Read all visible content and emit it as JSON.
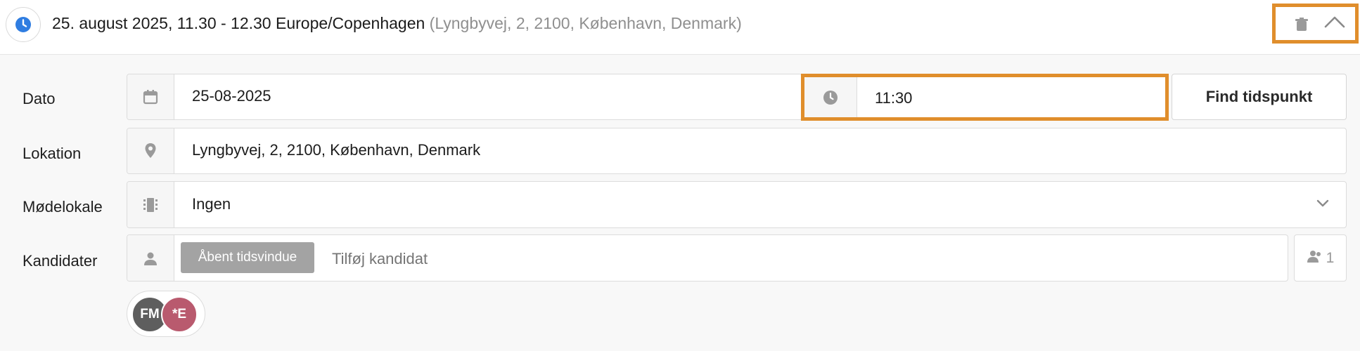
{
  "header": {
    "title": "25. august 2025, 11.30 - 12.30 Europe/Copenhagen",
    "location": "(Lyngbyvej, 2, 2100, København, Denmark)",
    "icons": {
      "clock": "clock-icon",
      "trash": "trash-icon",
      "collapse": "chevron-up-icon"
    }
  },
  "form": {
    "date": {
      "label": "Dato",
      "value": "25-08-2025",
      "icon": "calendar-icon"
    },
    "time": {
      "value": "11:30",
      "icon": "clock-icon"
    },
    "find_button": "Find tidspunkt",
    "location": {
      "label": "Lokation",
      "value": "Lyngbyvej, 2, 2100, København, Denmark",
      "icon": "map-pin-icon"
    },
    "room": {
      "label": "Mødelokale",
      "value": "Ingen",
      "icon": "meeting-room-icon"
    },
    "candidates": {
      "label": "Kandidater",
      "tag": "Åbent tidsvindue",
      "placeholder": "Tilføj kandidat",
      "count": "1",
      "icon": "person-icon"
    },
    "avatars": [
      {
        "initials": "FM",
        "color": "#5e5e5e"
      },
      {
        "initials": "*E",
        "color": "#b95a6e"
      }
    ]
  },
  "colors": {
    "highlight": "#e08e2c",
    "accent": "#2f7de1"
  }
}
